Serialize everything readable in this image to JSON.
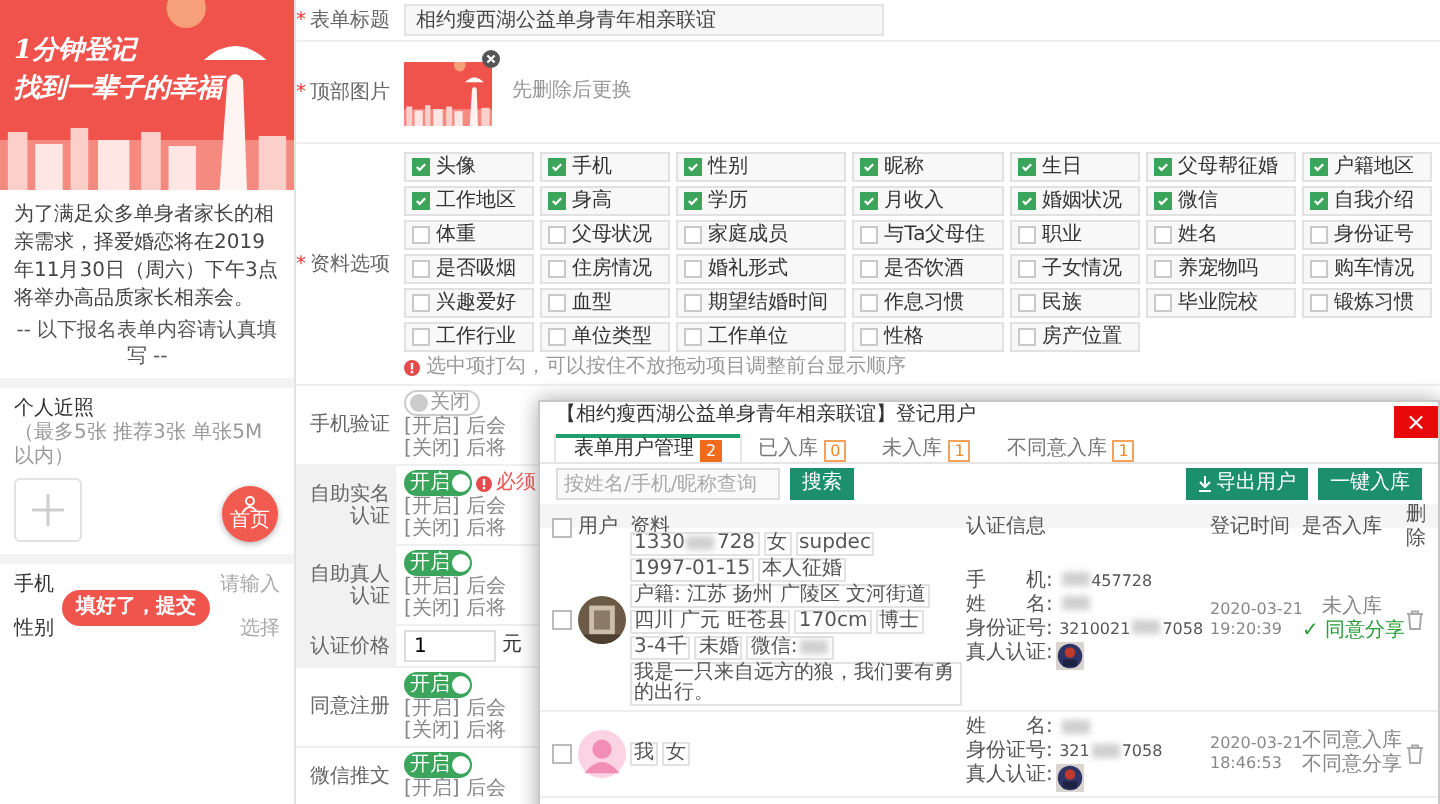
{
  "preview": {
    "banner": {
      "lines": [
        "1分钟登记",
        "找到一辈子的幸福"
      ]
    },
    "intro": "为了满足众多单身者家长的相亲需求，择爱婚恋将在2019年11月30日（周六）下午3点将举办高品质家长相亲会。",
    "note": "-- 以下报名表单内容请认真填写 --",
    "photos": {
      "label": "个人近照",
      "hint": "（最多5张 推荐3张 单张5M以内）"
    },
    "home_button": "首页",
    "fields": [
      {
        "label": "手机",
        "placeholder": "请输入"
      },
      {
        "label": "性别",
        "placeholder": "选择"
      }
    ],
    "submit": "填好了，提交"
  },
  "form": {
    "rows": [
      {
        "kind": "text",
        "required_mark": "*",
        "label": "表单标题",
        "highlighted": false,
        "value": "相约瘦西湖公益单身青年相亲联谊"
      },
      {
        "required_mark": "*",
        "label": "顶部图片",
        "highlighted": false,
        "hint": "先删除后更换"
      },
      {
        "kind": "options",
        "required_mark": "*",
        "label": "资料选项",
        "highlighted": false,
        "tip": "选中项打勾，可以按住不放拖动项目调整前台显示顺序",
        "options": [
          {
            "label": "头像",
            "checked": true
          },
          {
            "label": "手机",
            "checked": true
          },
          {
            "label": "性别",
            "checked": true
          },
          {
            "label": "昵称",
            "checked": true
          },
          {
            "label": "生日",
            "checked": true
          },
          {
            "label": "父母帮征婚",
            "checked": true
          },
          {
            "label": "户籍地区",
            "checked": true
          },
          {
            "label": "工作地区",
            "checked": true
          },
          {
            "label": "身高",
            "checked": true
          },
          {
            "label": "学历",
            "checked": true
          },
          {
            "label": "月收入",
            "checked": true
          },
          {
            "label": "婚姻状况",
            "checked": true
          },
          {
            "label": "微信",
            "checked": true
          },
          {
            "label": "自我介绍",
            "checked": true
          },
          {
            "label": "体重",
            "checked": false
          },
          {
            "label": "父母状况",
            "checked": false
          },
          {
            "label": "家庭成员",
            "checked": false
          },
          {
            "label": "与Ta父母住",
            "checked": false
          },
          {
            "label": "职业",
            "checked": false
          },
          {
            "label": "姓名",
            "checked": false
          },
          {
            "label": "身份证号",
            "checked": false
          },
          {
            "label": "是否吸烟",
            "checked": false
          },
          {
            "label": "住房情况",
            "checked": false
          },
          {
            "label": "婚礼形式",
            "checked": false
          },
          {
            "label": "是否饮酒",
            "checked": false
          },
          {
            "label": "子女情况",
            "checked": false
          },
          {
            "label": "养宠物吗",
            "checked": false
          },
          {
            "label": "购车情况",
            "checked": false
          },
          {
            "label": "兴趣爱好",
            "checked": false
          },
          {
            "label": "血型",
            "checked": false
          },
          {
            "label": "期望结婚时间",
            "checked": false
          },
          {
            "label": "作息习惯",
            "checked": false
          },
          {
            "label": "民族",
            "checked": false
          },
          {
            "label": "毕业院校",
            "checked": false
          },
          {
            "label": "锻炼习惯",
            "checked": false
          },
          {
            "label": "工作行业",
            "checked": false
          },
          {
            "label": "单位类型",
            "checked": false
          },
          {
            "label": "工作单位",
            "checked": false
          },
          {
            "label": "性格",
            "checked": false
          },
          {
            "label": "房产位置",
            "checked": false
          }
        ]
      },
      {
        "kind": "toggle",
        "label": "手机验证",
        "highlighted": false,
        "on": false,
        "switch_text": "关闭",
        "notes": [
          "[开启] 后会",
          "[关闭] 后将"
        ]
      },
      {
        "kind": "toggle",
        "label": "自助实名认证",
        "highlighted": true,
        "on": true,
        "switch_text": "开启",
        "warning": "必须",
        "notes": [
          "[开启] 后会",
          "[关闭] 后将"
        ]
      },
      {
        "kind": "toggle",
        "label": "自助真人认证",
        "highlighted": true,
        "on": true,
        "switch_text": "开启",
        "notes": [
          "[开启] 后会",
          "[关闭] 后将"
        ]
      },
      {
        "kind": "price",
        "label": "认证价格",
        "highlighted": true,
        "value": "1",
        "unit": "元"
      },
      {
        "kind": "toggle",
        "label": "同意注册",
        "highlighted": false,
        "on": true,
        "switch_text": "开启",
        "notes": [
          "[开启] 后会",
          "[关闭] 后将"
        ]
      },
      {
        "kind": "toggle",
        "label": "微信推文",
        "highlighted": false,
        "on": true,
        "switch_text": "开启",
        "notes": [
          "[开启] 后会"
        ]
      }
    ]
  },
  "modal": {
    "title": "【相约瘦西湖公益单身青年相亲联谊】登记用户",
    "close": "×",
    "tabs": [
      {
        "label": "表单用户管理",
        "count": "2",
        "selected": true
      },
      {
        "label": "已入库",
        "count": "0",
        "selected": false
      },
      {
        "label": "未入库",
        "count": "1",
        "selected": false
      },
      {
        "label": "不同意入库",
        "count": "1",
        "selected": false
      }
    ],
    "search": {
      "placeholder": "按姓名/手机/昵称查询",
      "button": "搜索"
    },
    "actions": [
      {
        "label": "导出用户",
        "kind": "export"
      },
      {
        "label": "一键入库",
        "kind": "plain"
      }
    ],
    "select_all": {
      "checked": false
    },
    "columns": [
      "用户",
      "资料",
      "认证信息",
      "登记时间",
      "是否入库",
      "删除"
    ],
    "rows": [
      {
        "checked": false,
        "avatar": {
          "kind": "picture"
        },
        "tags": [
          {
            "text": "1330",
            "blur": true,
            "after": "728"
          },
          {
            "text": "女",
            "blur": false
          },
          {
            "text": "supdec",
            "blur": false
          },
          {
            "text": "1997-01-15",
            "blur": false
          },
          {
            "text": "本人征婚",
            "blur": false
          },
          {
            "text": "户籍: 江苏 扬州 广陵区 文河街道",
            "blur": false
          },
          {
            "text": "四川 广元 旺苍县",
            "blur": false
          },
          {
            "text": "170cm",
            "blur": false
          },
          {
            "text": "博士",
            "blur": false
          },
          {
            "text": "3-4千",
            "blur": false
          },
          {
            "text": "未婚",
            "blur": false
          },
          {
            "text": "微信:",
            "blur": true
          },
          {
            "text": "我是一只来自远方的狼，我们要有勇的出行。",
            "blur": false
          }
        ],
        "auth": [
          {
            "kind": "text",
            "label": "手　　机:",
            "blur": true,
            "after": "457728"
          },
          {
            "kind": "text",
            "label": "姓　　名:",
            "blur": true
          },
          {
            "kind": "text",
            "label": "身份证号:",
            "value": "3210021",
            "blur": true,
            "after": "7058"
          },
          {
            "label": "真人认证:"
          }
        ],
        "time": [
          "2020-03-21",
          "19:20:39"
        ],
        "status": [
          {
            "text": "未入库",
            "color": "#888888"
          },
          {
            "text": "✓ 同意分享",
            "color": "#2a9d3a"
          }
        ]
      },
      {
        "checked": false,
        "avatar": {
          "kind": "silhouette"
        },
        "tags": [
          {
            "text": "我",
            "blur": false
          },
          {
            "text": "女",
            "blur": false
          }
        ],
        "auth": [
          {
            "kind": "text",
            "label": "姓　　名:",
            "blur": true
          },
          {
            "kind": "text",
            "label": "身份证号:",
            "value": "321",
            "blur": true,
            "after": "7058"
          },
          {
            "label": "真人认证:"
          }
        ],
        "time": [
          "2020-03-21",
          "18:46:53"
        ],
        "status": [
          {
            "text": "不同意入库",
            "color": "#888888"
          },
          {
            "text": "不同意分享",
            "color": "#888888"
          }
        ]
      }
    ]
  }
}
